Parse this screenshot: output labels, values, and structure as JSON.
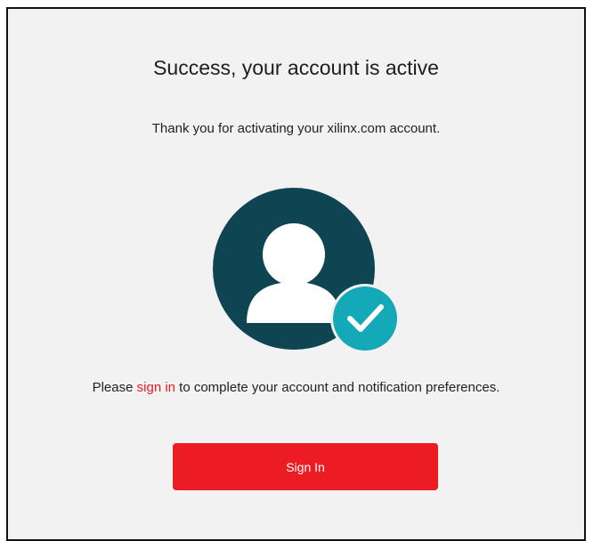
{
  "page": {
    "title": "Success, your account is active",
    "subtitle": "Thank you for activating your xilinx.com account."
  },
  "illustration": {
    "avatar_icon": "user-avatar-icon",
    "badge_icon": "checkmark-icon",
    "avatar_color": "#0f4453",
    "badge_color": "#13a9b8"
  },
  "prompt": {
    "before": "Please ",
    "link": "sign in",
    "after": " to complete your account and notification preferences."
  },
  "actions": {
    "signin_label": "Sign In"
  },
  "colors": {
    "accent": "#ec1c24",
    "link": "#e31b23",
    "panel_bg": "#f2f2f2"
  }
}
